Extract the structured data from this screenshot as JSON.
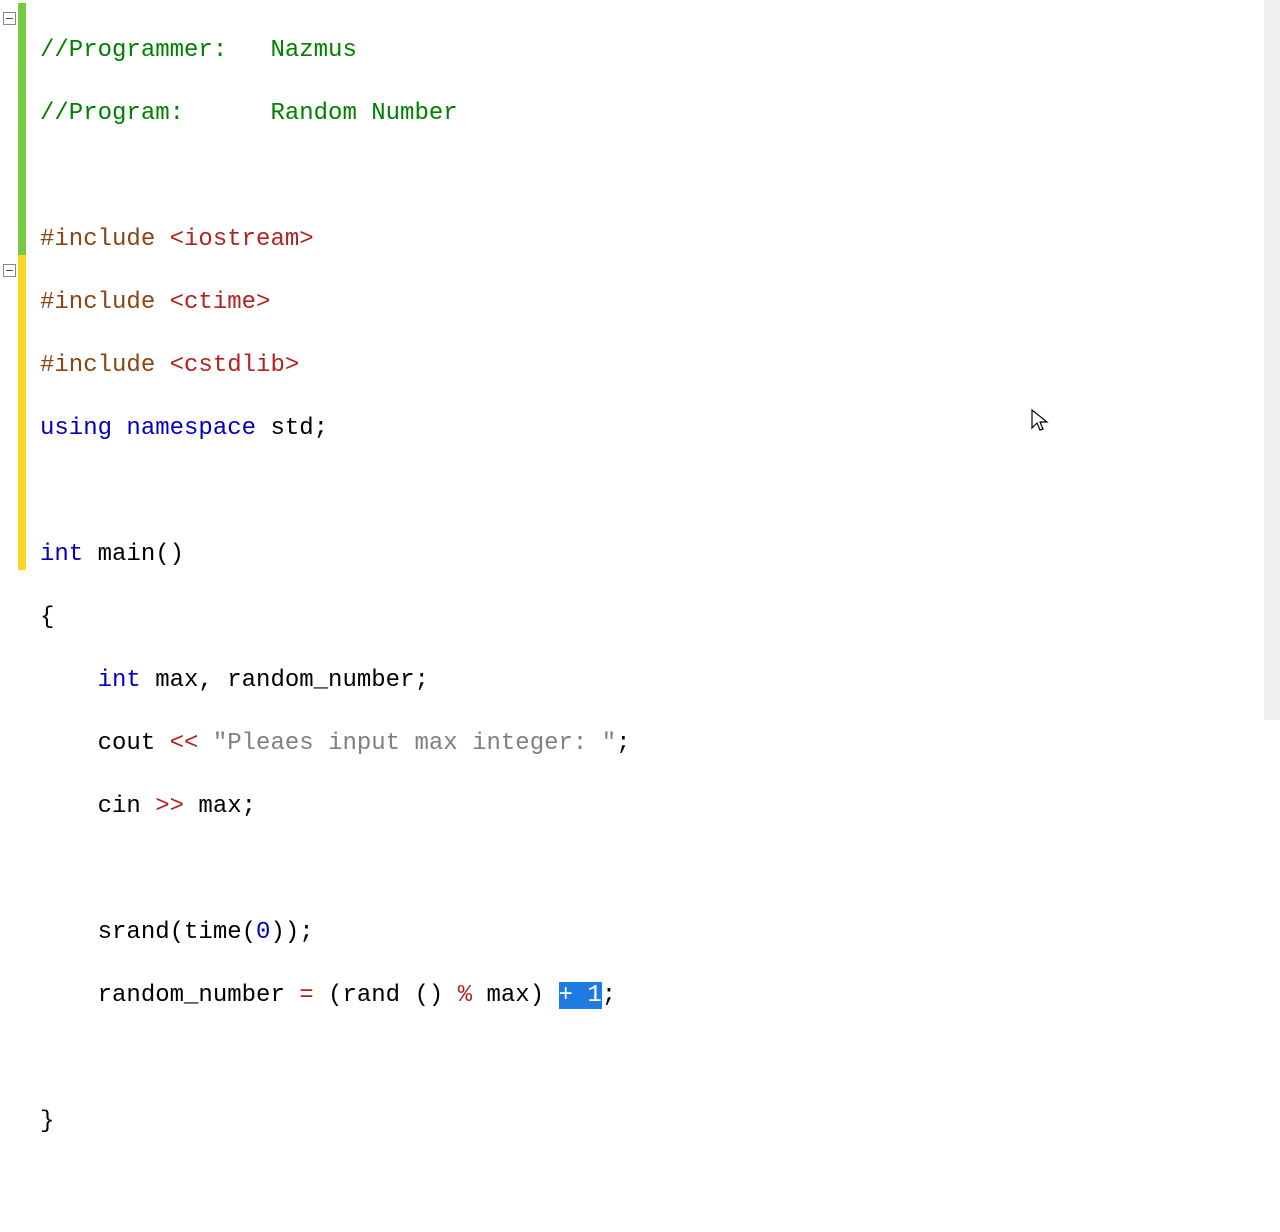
{
  "gutter": {
    "fold_positions": [
      0,
      8
    ]
  },
  "markers": [
    "green",
    "green",
    "green",
    "green",
    "green",
    "green",
    "green",
    "green",
    "yellow",
    "yellow",
    "yellow",
    "yellow",
    "yellow",
    "yellow",
    "yellow",
    "yellow",
    "yellow",
    "yellow"
  ],
  "code": {
    "l1_comment": "//Programmer:   Nazmus",
    "l2_comment": "//Program:      Random Number",
    "l4_pre": "#include ",
    "l4_ang": "<iostream>",
    "l5_pre": "#include ",
    "l5_ang": "<ctime>",
    "l6_pre": "#include ",
    "l6_ang": "<cstdlib>",
    "l7_kw1": "using",
    "l7_kw2": "namespace",
    "l7_id": " std;",
    "l9_kw": "int",
    "l9_fn": " main()",
    "l10": "{",
    "l11_indent": "    ",
    "l11_kw": "int",
    "l11_rest": " max, random_number;",
    "l12_indent": "    cout ",
    "l12_op": "<<",
    "l12_sp": " ",
    "l12_str": "\"Pleaes input max integer: \"",
    "l12_end": ";",
    "l13_indent": "    cin ",
    "l13_op": ">>",
    "l13_rest": " max;",
    "l15_indent": "    srand(time(",
    "l15_num": "0",
    "l15_end": "));",
    "l16_indent": "    random_number ",
    "l16_eq": "=",
    "l16_p1": " (rand () ",
    "l16_mod": "%",
    "l16_p2": " max) ",
    "l16_sel": "+ 1",
    "l16_end": ";",
    "l18": "}"
  }
}
